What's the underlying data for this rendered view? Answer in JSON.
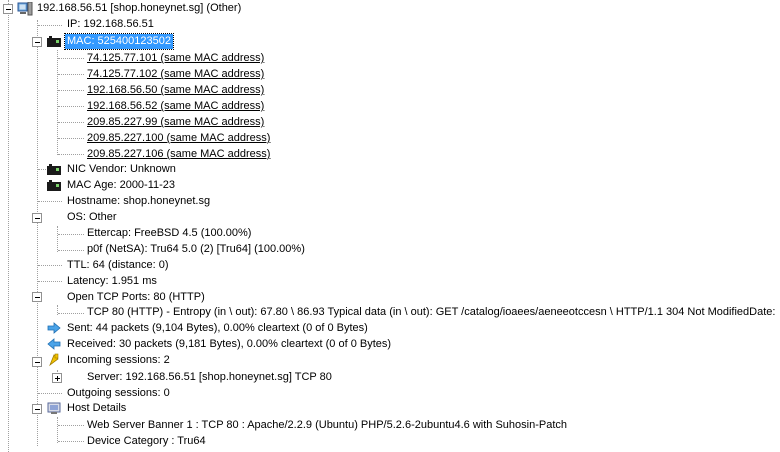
{
  "host": {
    "title": "192.168.56.51 [shop.honeynet.sg] (Other)",
    "ip": "IP: 192.168.56.51",
    "mac": {
      "label": "MAC: 525400123502",
      "same": [
        "74.125.77.101 (same MAC address)",
        "74.125.77.102 (same MAC address)",
        "192.168.56.50 (same MAC address)",
        "192.168.56.52 (same MAC address)",
        "209.85.227.99 (same MAC address)",
        "209.85.227.100 (same MAC address)",
        "209.85.227.106 (same MAC address)"
      ]
    },
    "nic_vendor": "NIC Vendor: Unknown",
    "mac_age": "MAC Age: 2000-11-23",
    "hostname": "Hostname: shop.honeynet.sg",
    "os": {
      "label": "OS: Other",
      "ettercap": "Ettercap: FreeBSD 4.5 (100.00%)",
      "p0f": "p0f (NetSA): Tru64 5.0 (2) [Tru64] (100.00%)"
    },
    "ttl": "TTL: 64 (distance: 0)",
    "latency": "Latency: 1.951 ms",
    "open_ports": {
      "label": "Open TCP Ports: 80 (HTTP)",
      "port80": "TCP 80 (HTTP) - Entropy (in \\ out): 67.80 \\ 86.93 Typical data (in \\ out): GET /catalog/ioaees/aeneeotccesn \\ HTTP/1.1 304 Not ModifiedDate:"
    },
    "sent": "Sent: 44 packets (9,104 Bytes), 0.00% cleartext (0 of 0 Bytes)",
    "received": "Received: 30 packets (9,181 Bytes), 0.00% cleartext (0 of 0 Bytes)",
    "incoming": {
      "label": "Incoming sessions: 2",
      "server": "Server: 192.168.56.51 [shop.honeynet.sg] TCP 80"
    },
    "outgoing": "Outgoing sessions: 0",
    "details": {
      "label": "Host Details",
      "banner": "Web Server Banner 1 : TCP 80 : Apache/2.2.9 (Ubuntu) PHP/5.2.6-2ubuntu4.6 with Suhosin-Patch",
      "category": "Device Category : Tru64"
    }
  },
  "colors": {
    "selection": "#3399ff",
    "tree_lines": "#a0a0a0",
    "nic_icon": "#1a1a1a"
  }
}
